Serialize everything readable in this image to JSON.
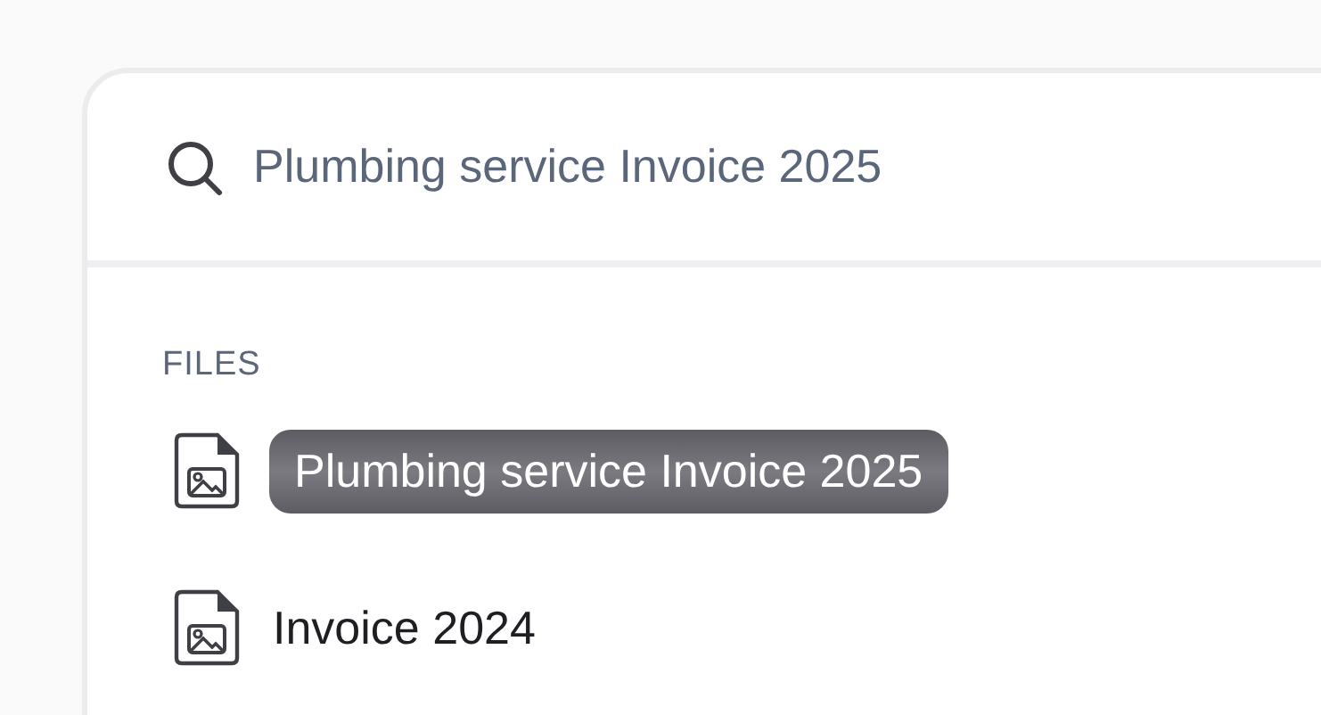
{
  "search": {
    "query": "Plumbing service Invoice 2025"
  },
  "sections": [
    {
      "heading": "FILES",
      "items": [
        {
          "name": "Plumbing service Invoice 2025",
          "selected": true
        },
        {
          "name": "Invoice 2024",
          "selected": false
        }
      ]
    }
  ]
}
